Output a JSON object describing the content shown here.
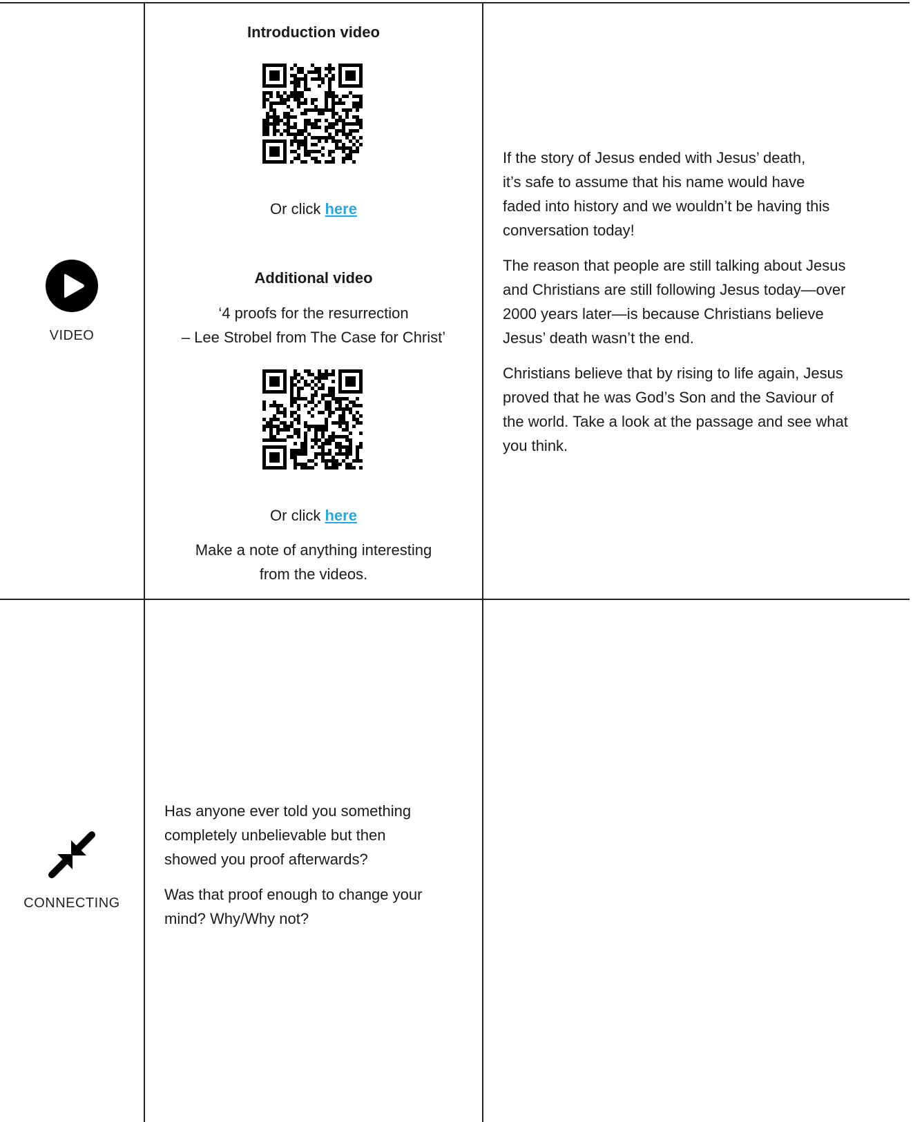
{
  "video_row": {
    "icon_label": "VIDEO",
    "intro_heading": "Introduction video",
    "intro_click_prefix": "Or click ",
    "intro_link": "here",
    "additional_heading": "Additional video",
    "additional_title_line1": "‘4 proofs for the resurrection",
    "additional_title_line2": "– Lee Strobel from The Case for Christ’",
    "additional_click_prefix": "Or click ",
    "additional_link": "here",
    "note_line1": "Make a note of anything interesting",
    "note_line2": "from the videos.",
    "right_paragraphs": [
      "If the story of Jesus ended with Jesus’ death,\nit’s safe to assume that his name would have\nfaded into history and we wouldn’t be having this\nconversation today!",
      "The reason that people are still talking about Jesus\nand Christians are still following Jesus today—over\n2000 years later—is because Christians believe\nJesus’ death wasn’t the end.",
      "Christians believe that by rising to life again, Jesus\nproved that he was God’s Son and the Saviour of\nthe world. Take a look at the passage and see what\nyou think."
    ]
  },
  "connecting_row": {
    "icon_label": "CONNECTING",
    "paragraphs": [
      "Has anyone ever told you something\ncompletely unbelievable but then\nshowed you proof afterwards?",
      "Was that proof enough to change your\nmind? Why/Why not?"
    ]
  },
  "colors": {
    "link": "#2aa7d6",
    "lines": "#222222",
    "text": "#1a1a1a"
  },
  "icons": {
    "video": "play-circle-icon",
    "connecting": "arrows-converge-icon",
    "qr": "qr-code-icon"
  }
}
